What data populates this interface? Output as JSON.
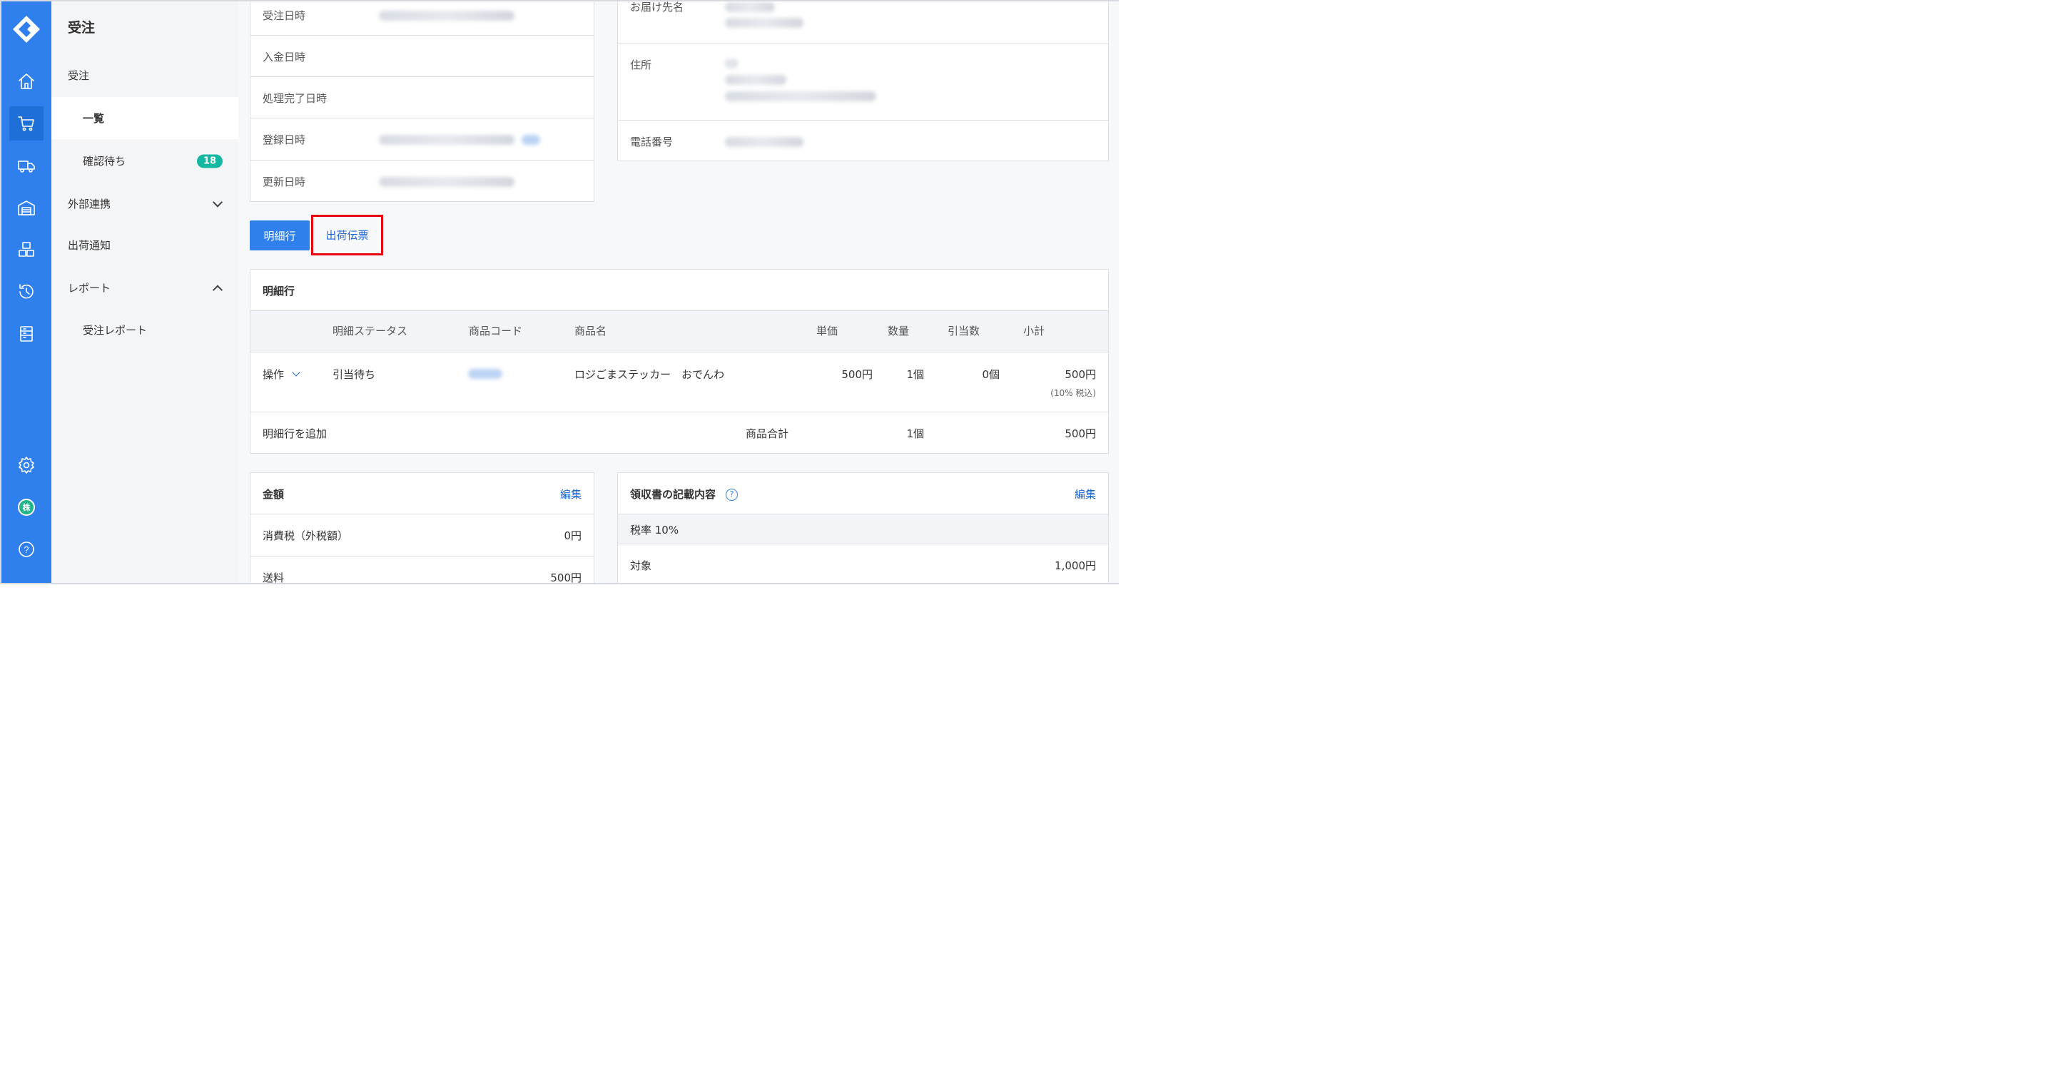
{
  "app": {
    "section_title": "受注",
    "colors": {
      "rail": "#2f80ed",
      "accent": "#1c66d6",
      "badge": "#14b8a0",
      "alert": "#e8344e",
      "highlight_box": "#e60012"
    }
  },
  "rail": {
    "icons": [
      "logo-icon",
      "home-icon",
      "cart-icon",
      "truck-icon",
      "warehouse-icon",
      "boxes-icon",
      "history-icon",
      "list-icon",
      "settings-icon",
      "company-icon",
      "help-icon"
    ],
    "company_glyph": "株",
    "help_glyph": "?"
  },
  "sidebar": {
    "items": [
      {
        "label": "受注"
      },
      {
        "label": "一覧"
      },
      {
        "label": "確認待ち",
        "badge": "18"
      },
      {
        "label": "外部連携"
      },
      {
        "label": "出荷通知"
      },
      {
        "label": "レポート"
      },
      {
        "label": "受注レポート"
      }
    ]
  },
  "info_left": {
    "rows": [
      {
        "label": "受注日時"
      },
      {
        "label": "入金日時"
      },
      {
        "label": "処理完了日時"
      },
      {
        "label": "登録日時"
      },
      {
        "label": "更新日時"
      }
    ]
  },
  "info_right": {
    "rows": [
      {
        "label": "お届け先名"
      },
      {
        "label": "住所"
      },
      {
        "label": "電話番号"
      }
    ]
  },
  "tabs": {
    "detail": "明細行",
    "shipping_slip": "出荷伝票"
  },
  "line_items": {
    "title": "明細行",
    "headers": [
      "明細ステータス",
      "商品コード",
      "商品名",
      "単価",
      "数量",
      "引当数",
      "小計"
    ],
    "row": {
      "action": "操作",
      "status": "引当待ち",
      "product_name": "ロジごまステッカー　おでんわ",
      "unit_price": "500円",
      "quantity": "1個",
      "allocated": "0個",
      "subtotal": "500円",
      "tax_note": "(10% 税込)"
    },
    "add_link": "明細行を追加",
    "total_label": "商品合計",
    "total_quantity": "1個",
    "total_amount": "500円"
  },
  "amount": {
    "title": "金額",
    "edit": "編集",
    "rows": [
      {
        "label": "消費税（外税額）",
        "value": "0円"
      },
      {
        "label": "送料",
        "value": "500円"
      }
    ]
  },
  "receipt": {
    "title": "領収書の記載内容",
    "help": "?",
    "edit": "編集",
    "tax_rate": "税率 10%",
    "rows": [
      {
        "label": "対象",
        "value": "1,000円"
      }
    ]
  }
}
